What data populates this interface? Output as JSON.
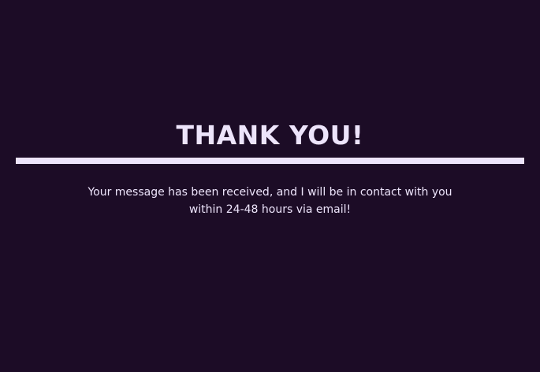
{
  "confirmation": {
    "title": "THANK YOU!",
    "message": "Your message has been received, and I will be in contact with you within 24-48 hours via email!"
  },
  "colors": {
    "background": "#1c0c26",
    "text": "#ede4fb",
    "divider": "#ede4fb"
  }
}
